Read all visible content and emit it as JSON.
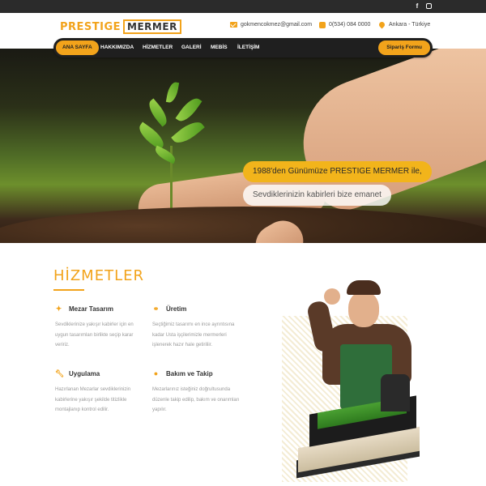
{
  "topbar": {
    "social": [
      "f",
      "instagram"
    ]
  },
  "header": {
    "logo_word1": "PRESTIGE",
    "logo_word2": "MERMER",
    "email": "gokmencokmez@gmail.com",
    "phone": "0(534) 084 0000",
    "location": "Ankara - Türkiye",
    "icons": {
      "email": "envelope-icon",
      "phone": "phone-icon",
      "location": "map-pin-icon"
    }
  },
  "nav": {
    "items": [
      "ANA SAYFA",
      "HAKKIMIZDA",
      "HİZMETLER",
      "GALERİ",
      "MEBİS",
      "İLETİŞİM"
    ],
    "active_index": 0,
    "order_button": "Sipariş Formu"
  },
  "hero": {
    "line1": "1988'den Günümüze PRESTIGE MERMER ile,",
    "line2": "Sevdiklerinizin kabirleri bize emanet"
  },
  "services": {
    "title": "HİZMETLER",
    "items": [
      {
        "title": "Mezar Tasarım",
        "icon": "wand-icon",
        "desc": "Sevdiklerinize yakışır kabirler için en uygun tasarımları birlikte seçip karar veririz."
      },
      {
        "title": "Üretim",
        "icon": "link-icon",
        "desc": "Seçtiğimiz tasarımı en ince ayrıntısına kadar Usta işçilerimizle mermerleri işlenerek hazır hale getiriliir."
      },
      {
        "title": "Uygulama",
        "icon": "wrench-icon",
        "desc": "Hazırlanan Mezarlar sevdiklerinizin kabirlerine yakışır şekilde titizlikle montajlanıp kontrol edilir."
      },
      {
        "title": "Bakım ve Takip",
        "icon": "user-icon",
        "desc": "Mezarlarınız isteğiniz doğrultusunda düzenle takip edilip, bakım ve onarımları yapılır."
      }
    ]
  },
  "colors": {
    "accent": "#f2a31b",
    "dark": "#1f1f1f",
    "muted": "#9a9a9a"
  }
}
